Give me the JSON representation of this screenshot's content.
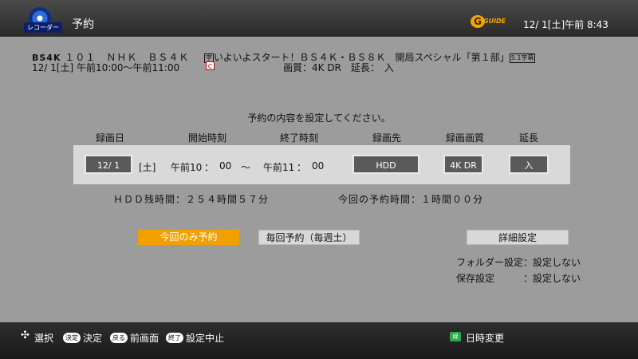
{
  "header": {
    "app_name": "予約",
    "disc_caption": "レコーダー",
    "guide_logo_letter": "G",
    "guide_logo_text": "GUIDE",
    "clock": "12/ 1[土]午前 8:43"
  },
  "program": {
    "channel_badge": "BS4K",
    "channel": "１０１　ＮＨＫ　ＢＳ４Ｋ",
    "datetime": "12/ 1[土] 午前10:00～午前11:00",
    "title": "いよいよスタート！ＢＳ４Ｋ・ＢＳ８Ｋ　開局スペシャル「第１部」",
    "mark_prefix": "字",
    "mark_suffix": "5.1字幕",
    "c_mark": "C",
    "quality": "画質：4K DR　延長：　入"
  },
  "form": {
    "prompt": "予約の内容を設定してください。",
    "headers": {
      "date": "録画日",
      "start": "開始時刻",
      "end": "終了時刻",
      "dest": "録画先",
      "quality": "録画画質",
      "ext": "延長"
    },
    "values": {
      "date": "12/ 1",
      "weekday": "[土]",
      "start_period": "午前10",
      "start_sep": "：",
      "start_min": "00",
      "tilde": "～",
      "end_period": "午前11",
      "end_sep": "：",
      "end_min": "00",
      "dest": "HDD",
      "quality": "4K DR",
      "ext": "入"
    }
  },
  "info": {
    "hdd_remaining": "ＨＤＤ残時間：２５４時間５７分",
    "rec_time": "今回の予約時間：１時間００分"
  },
  "buttons": {
    "once": "今回のみ予約",
    "weekly": "毎回予約（毎週土）",
    "detail": "詳細設定"
  },
  "settings": {
    "folder": "フォルダー設定：設定しない",
    "save": "保存設定　　　：設定しない"
  },
  "footer": {
    "select_icon": "✣",
    "select": "選択",
    "ok_key": "決定",
    "ok": "決定",
    "back_key": "戻る",
    "back": "前画面",
    "end_key": "終了",
    "end": "設定中止",
    "green_key": "緑",
    "green": "日時変更"
  },
  "colors": {
    "accent": "#f2a000",
    "background": "#9c9c9c",
    "green_key": "#2da84a"
  }
}
